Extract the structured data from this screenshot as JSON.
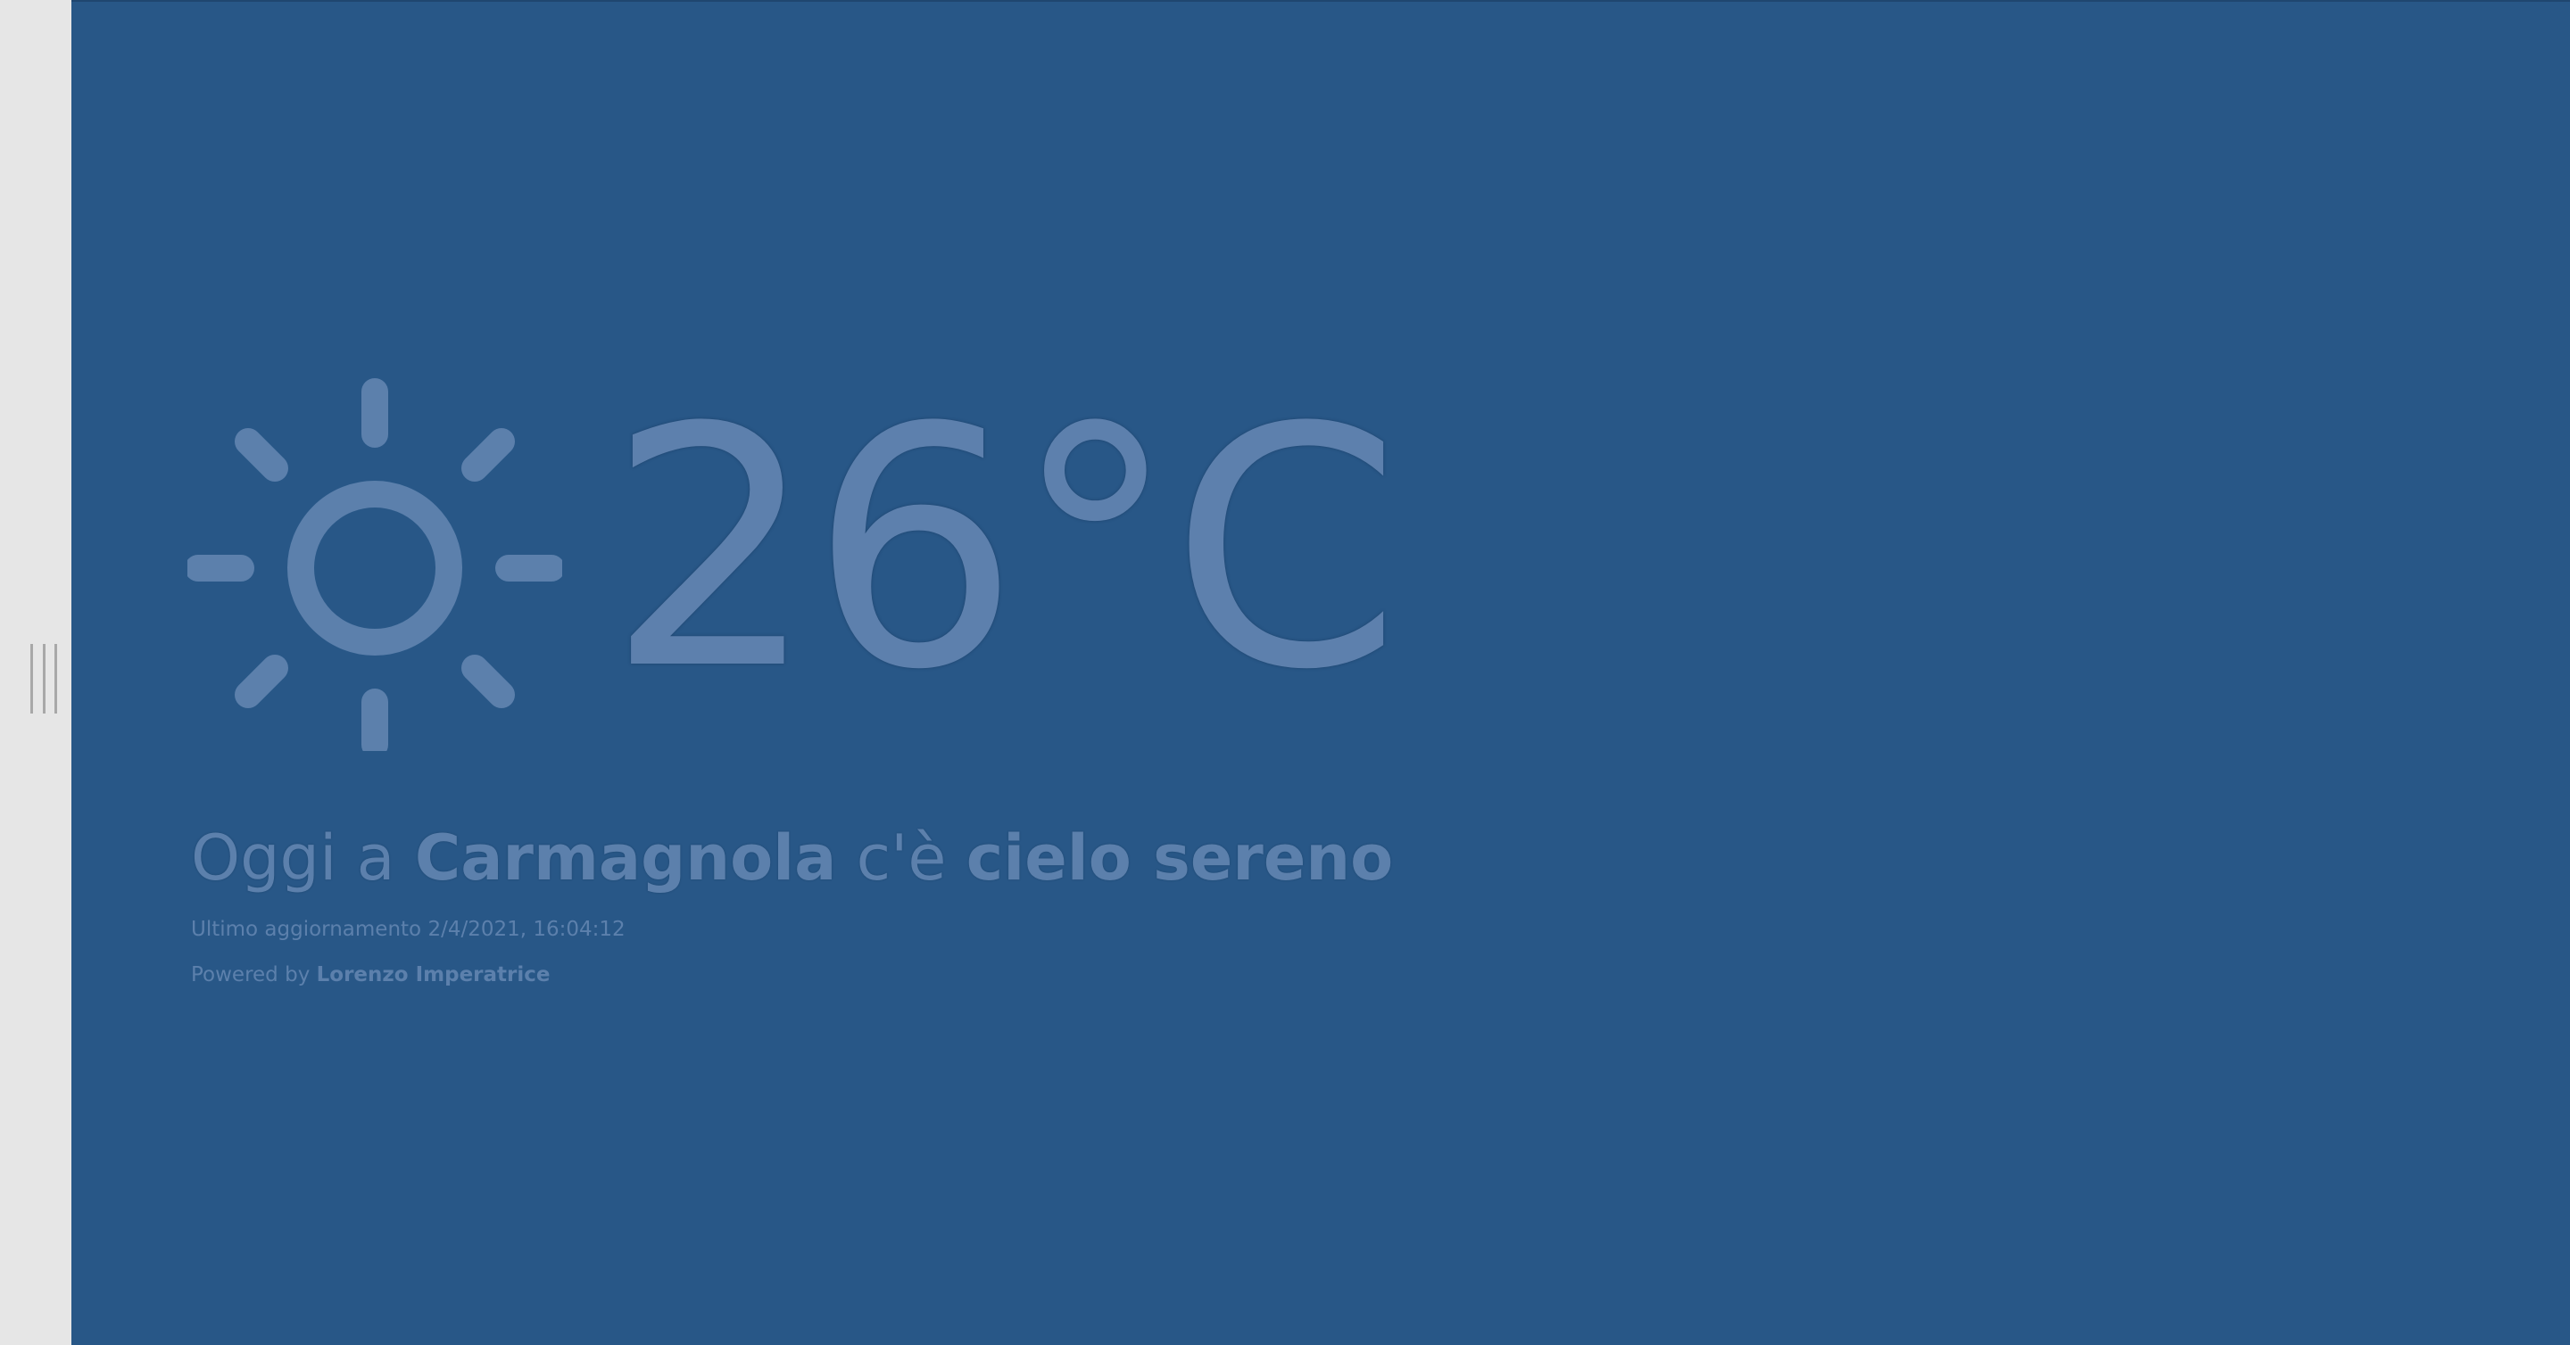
{
  "weather": {
    "icon": "sun-icon",
    "temperature": "26°C",
    "condition_prefix": "Oggi a",
    "city": "Carmagnola",
    "condition_mid": "c'è",
    "condition": "cielo sereno",
    "last_update_label": "Ultimo aggiornamento",
    "last_update_value": "2/4/2021, 16:04:12",
    "powered_by_label": "Powered by",
    "author": "Lorenzo Imperatrice"
  },
  "colors": {
    "background": "#285787",
    "foreground": "#5c80ac",
    "side_panel": "#e6e6e6",
    "handle": "#a8a8a8"
  }
}
